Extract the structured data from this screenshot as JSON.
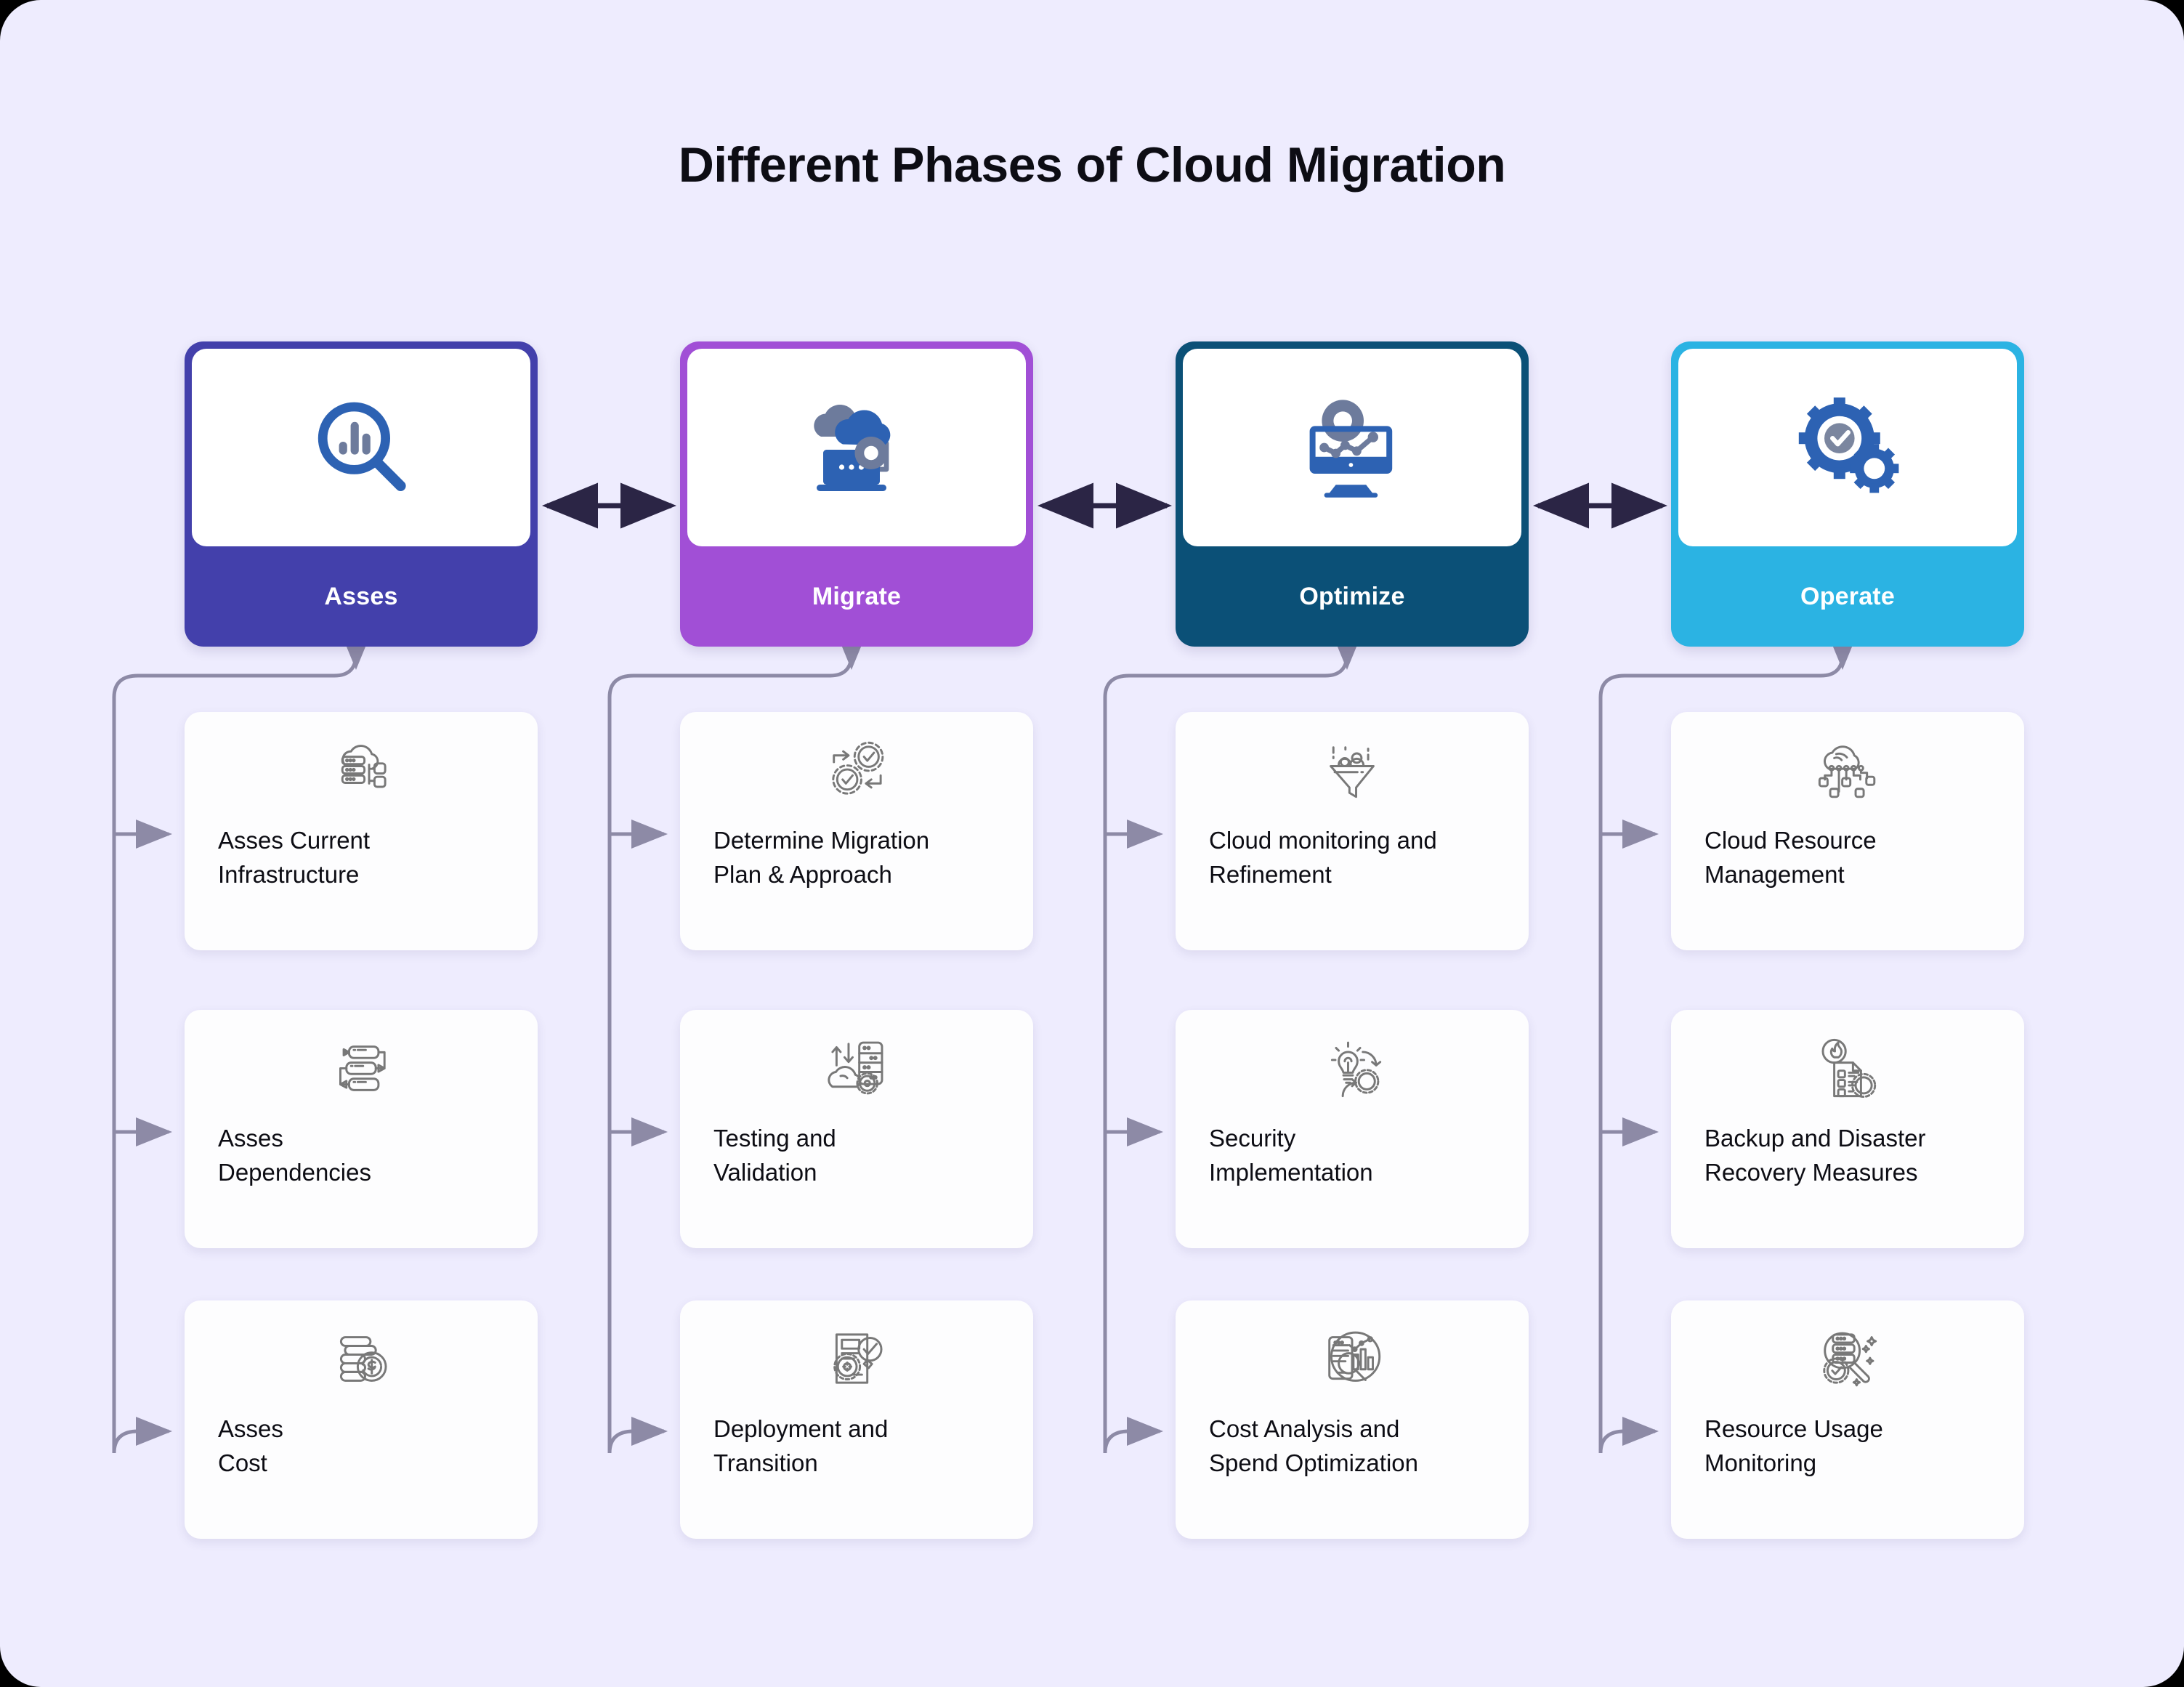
{
  "page": {
    "title": "Different Phases of Cloud Migration",
    "background_color": "#eeecfe",
    "arrow_color": "#2b2545",
    "branch_line_color": "#8d8aa6"
  },
  "phases": [
    {
      "label": "Asses",
      "color": "#4340ab",
      "icon": "magnifier-bar-chart-icon",
      "steps": [
        {
          "label": "Asses Current\nInfrastructure",
          "icon": "cloud-server-infrastructure-icon"
        },
        {
          "label": "Asses\nDependencies",
          "icon": "dependency-flow-icon"
        },
        {
          "label": "Asses\nCost",
          "icon": "coins-dollar-icon"
        }
      ]
    },
    {
      "label": "Migrate",
      "color": "#a14fd6",
      "icon": "cloud-laptop-gear-icon",
      "steps": [
        {
          "label": "Determine Migration\nPlan & Approach",
          "icon": "gears-check-arrows-icon"
        },
        {
          "label": "Testing and\nValidation",
          "icon": "server-cloud-transfer-icon"
        },
        {
          "label": "Deployment and\nTransition",
          "icon": "document-gear-magnifier-check-icon"
        }
      ]
    },
    {
      "label": "Optimize",
      "color": "#0b5077",
      "icon": "monitor-chart-gear-icon",
      "steps": [
        {
          "label": "Cloud monitoring and\nRefinement",
          "icon": "funnel-filter-icon"
        },
        {
          "label": "Security\nImplementation",
          "icon": "lightbulb-gear-cycle-icon"
        },
        {
          "label": "Cost Analysis and\nSpend Optimization",
          "icon": "mobile-analytics-magnifier-icon"
        }
      ]
    },
    {
      "label": "Operate",
      "color": "#2bb3e3",
      "icon": "gears-check-badge-icon",
      "steps": [
        {
          "label": "Cloud Resource\nManagement",
          "icon": "cloud-network-nodes-icon"
        },
        {
          "label": "Backup and Disaster\nRecovery Measures",
          "icon": "fire-checklist-gear-icon"
        },
        {
          "label": "Resource Usage\nMonitoring",
          "icon": "server-magnifier-badge-icon"
        }
      ]
    }
  ]
}
